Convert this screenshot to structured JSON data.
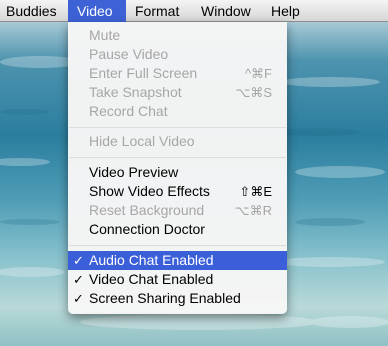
{
  "menubar": {
    "items": [
      "Buddies",
      "Video",
      "Format",
      "Window",
      "Help"
    ]
  },
  "video_menu": {
    "group1": [
      {
        "label": "Mute",
        "shortcut": ""
      },
      {
        "label": "Pause Video",
        "shortcut": ""
      },
      {
        "label": "Enter Full Screen",
        "shortcut": "^⌘F"
      },
      {
        "label": "Take Snapshot",
        "shortcut": "⌥⌘S"
      },
      {
        "label": "Record Chat",
        "shortcut": ""
      }
    ],
    "group2": [
      {
        "label": "Hide Local Video",
        "shortcut": ""
      }
    ],
    "group3": [
      {
        "label": "Video Preview",
        "shortcut": ""
      },
      {
        "label": "Show Video Effects",
        "shortcut": "⇧⌘E"
      },
      {
        "label": "Reset Background",
        "shortcut": "⌥⌘R"
      },
      {
        "label": "Connection Doctor",
        "shortcut": ""
      }
    ],
    "group4": [
      {
        "label": "Audio Chat Enabled",
        "check": "✓"
      },
      {
        "label": "Video Chat Enabled",
        "check": "✓"
      },
      {
        "label": "Screen Sharing Enabled",
        "check": "✓"
      }
    ]
  }
}
